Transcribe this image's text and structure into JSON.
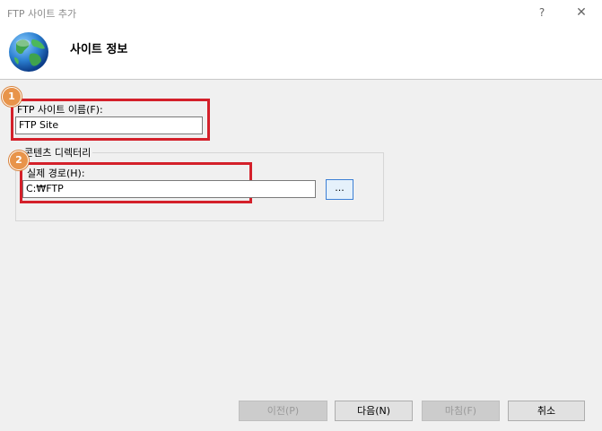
{
  "window": {
    "title": "FTP 사이트 추가",
    "help_glyph": "?",
    "close_glyph": "✕"
  },
  "header": {
    "title": "사이트 정보",
    "icon": "globe-icon"
  },
  "annotations": {
    "badge1": "1",
    "badge2": "2",
    "highlight_color": "#d4202a",
    "badge_color": "#e8944a"
  },
  "form": {
    "site_name_label": "FTP 사이트 이름(F):",
    "site_name_value": "FTP Site",
    "content_group_label": "콘텐츠 디렉터리",
    "physical_path_label": "실제 경로(H):",
    "physical_path_value": "C:₩FTP",
    "browse_label": "..."
  },
  "footer": {
    "prev_label": "이전(P)",
    "next_label": "다음(N)",
    "finish_label": "마침(F)",
    "cancel_label": "취소"
  }
}
